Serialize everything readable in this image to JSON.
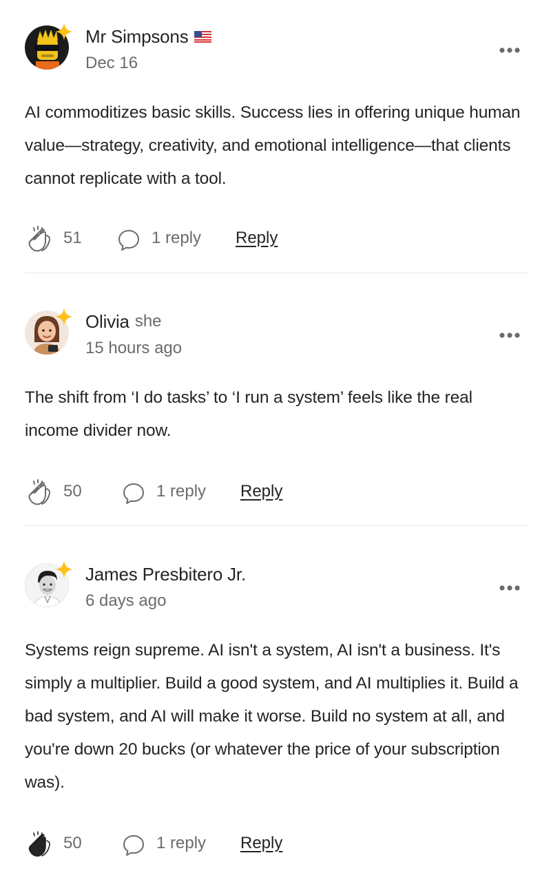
{
  "comments": [
    {
      "author": "Mr Simpsons",
      "flag_icon": "us-flag-icon",
      "date": "Dec 16",
      "text": "AI commoditizes basic skills. Success lies in offering unique human value—strategy, creativity, and emotional intelligence—that clients cannot replicate with a tool.",
      "claps": "51",
      "replies": "1 reply",
      "reply_label": "Reply"
    },
    {
      "author": "Olivia",
      "pronoun": "she",
      "date": "15 hours ago",
      "text": "The shift from ‘I do tasks’ to ‘I run a system’ feels like the real income divider now.",
      "claps": "50",
      "replies": "1 reply",
      "reply_label": "Reply"
    },
    {
      "author": "James Presbitero Jr.",
      "date": "6 days ago",
      "text": "Systems reign supreme. AI isn't a system, AI isn't a business. It's simply a multiplier. Build a good system, and AI multiplies it. Build a bad system, and AI will make it worse. Build no system at all, and you're down 20 bucks (or whatever the price of your subscription was).",
      "claps": "50",
      "replies": "1 reply",
      "reply_label": "Reply"
    }
  ],
  "colors": {
    "text": "#242424",
    "muted": "#6b6b6b",
    "divider": "#e6e6e6",
    "member_star": "#ffc017"
  }
}
